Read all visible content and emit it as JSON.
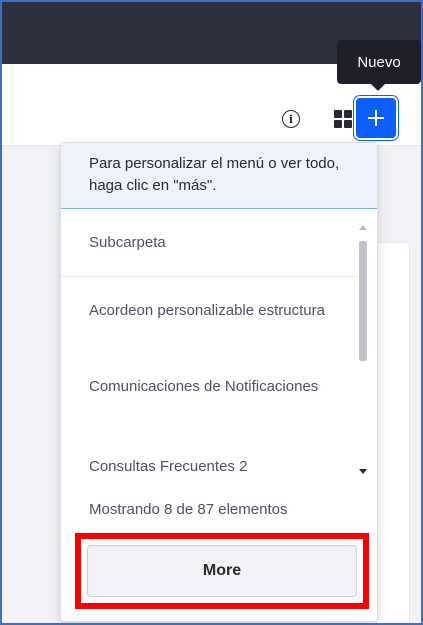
{
  "tooltip": {
    "text": "Nuevo"
  },
  "toolbar": {
    "info_icon": "info-circle-icon",
    "apps_icon": "grid-icon",
    "add_icon": "plus-icon",
    "accent_color": "#0b5fff"
  },
  "dropdown": {
    "help_text": "Para personalizar el menú o ver todo, haga clic en \"más\".",
    "items": [
      {
        "label": "Subcarpeta"
      },
      {
        "label": "Acordeon personalizable estructura"
      },
      {
        "label": "Comunicaciones de Notificaciones"
      },
      {
        "label": "Consultas Frecuentes 2"
      }
    ],
    "count_text": "Mostrando 8 de 87 elementos",
    "more_label": "More",
    "highlight_color": "#ff0000"
  }
}
